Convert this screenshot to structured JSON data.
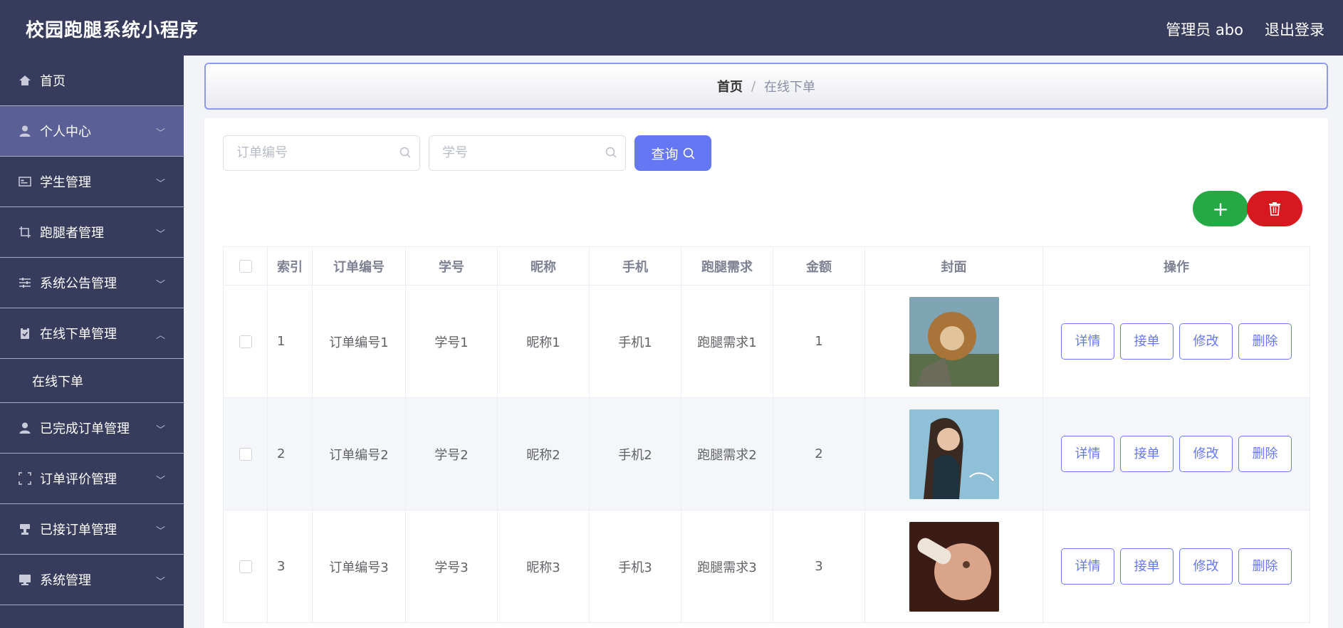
{
  "header": {
    "title": "校园跑腿系统小程序",
    "user": "管理员 abo",
    "logout": "退出登录"
  },
  "sidebar": {
    "items": [
      {
        "label": "首页",
        "icon": "home-icon"
      },
      {
        "label": "个人中心",
        "icon": "user-icon"
      },
      {
        "label": "学生管理",
        "icon": "id-card-icon"
      },
      {
        "label": "跑腿者管理",
        "icon": "crop-icon"
      },
      {
        "label": "系统公告管理",
        "icon": "sliders-icon"
      },
      {
        "label": "在线下单管理",
        "icon": "clipboard-icon"
      },
      {
        "label": "已完成订单管理",
        "icon": "user-icon"
      },
      {
        "label": "订单评价管理",
        "icon": "frame-icon"
      },
      {
        "label": "已接订单管理",
        "icon": "stamp-icon"
      },
      {
        "label": "系统管理",
        "icon": "monitor-icon"
      }
    ],
    "sub_item": "在线下单"
  },
  "breadcrumb": {
    "home": "首页",
    "separator": "/",
    "current": "在线下单"
  },
  "search": {
    "order_placeholder": "订单编号",
    "student_placeholder": "学号",
    "query_label": "查询"
  },
  "actions": {
    "add": "+"
  },
  "table": {
    "headers": [
      "索引",
      "订单编号",
      "学号",
      "昵称",
      "手机",
      "跑腿需求",
      "金额",
      "封面",
      "操作"
    ],
    "rows": [
      {
        "index": "1",
        "order_no": "订单编号1",
        "student_no": "学号1",
        "nickname": "昵称1",
        "phone": "手机1",
        "need": "跑腿需求1",
        "amount": "1"
      },
      {
        "index": "2",
        "order_no": "订单编号2",
        "student_no": "学号2",
        "nickname": "昵称2",
        "phone": "手机2",
        "need": "跑腿需求2",
        "amount": "2"
      },
      {
        "index": "3",
        "order_no": "订单编号3",
        "student_no": "学号3",
        "nickname": "昵称3",
        "phone": "手机3",
        "need": "跑腿需求3",
        "amount": "3"
      }
    ],
    "ops": [
      "详情",
      "接单",
      "修改",
      "删除"
    ]
  },
  "colors": {
    "sidebar_bg": "#383c5c",
    "accent": "#6677f4",
    "add": "#24a944",
    "delete": "#d5191f"
  }
}
